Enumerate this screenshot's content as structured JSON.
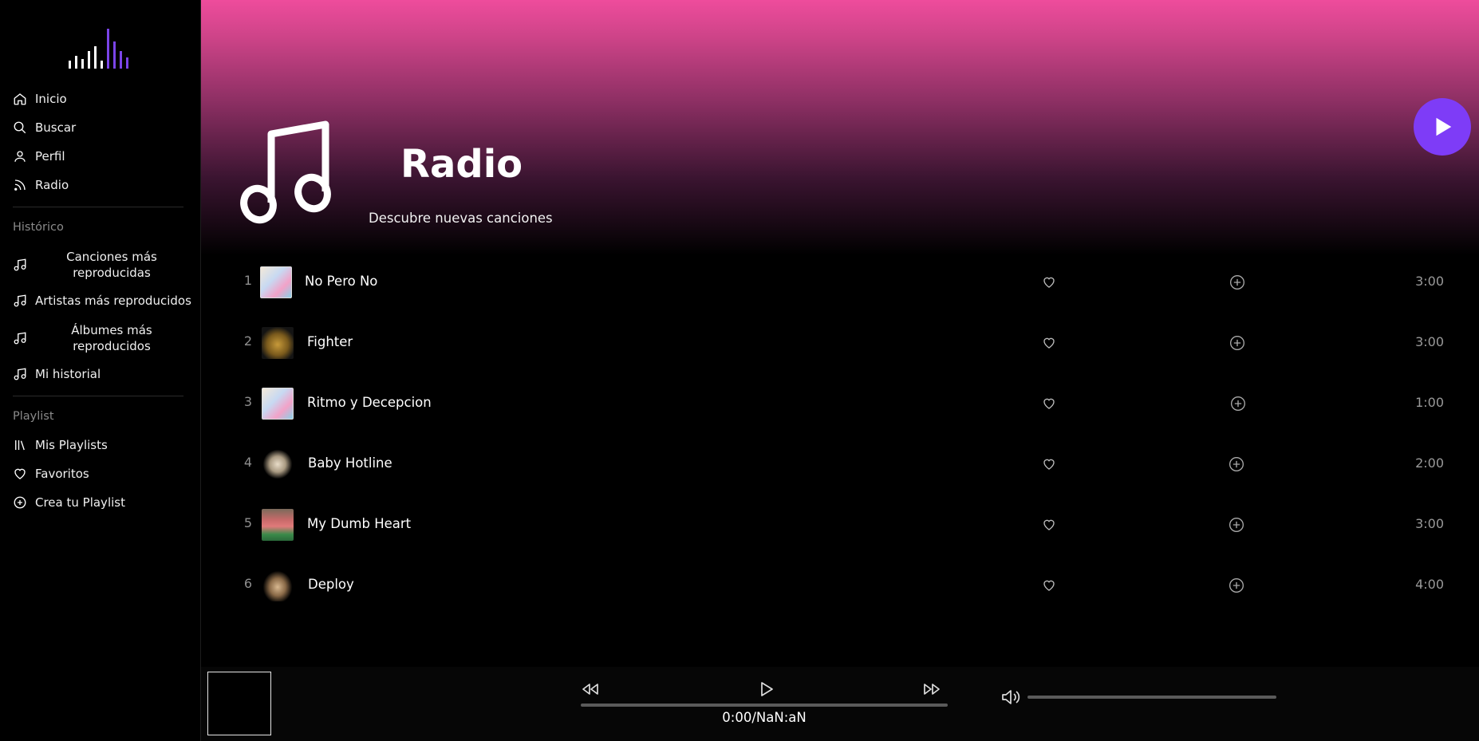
{
  "sidebar": {
    "nav": [
      {
        "label": "Inicio",
        "icon": "home-icon"
      },
      {
        "label": "Buscar",
        "icon": "search-icon"
      },
      {
        "label": "Perfil",
        "icon": "user-icon"
      },
      {
        "label": "Radio",
        "icon": "rss-icon"
      }
    ],
    "history_label": "Histórico",
    "history": [
      {
        "label": "Canciones más reproducidas",
        "icon": "music-note-icon"
      },
      {
        "label": "Artistas más reproducidos",
        "icon": "music-note-icon"
      },
      {
        "label": "Álbumes más reproducidos",
        "icon": "music-note-icon"
      },
      {
        "label": "Mi historial",
        "icon": "music-note-icon"
      }
    ],
    "playlist_label": "Playlist",
    "playlist": [
      {
        "label": "Mis Playlists",
        "icon": "library-icon"
      },
      {
        "label": "Favoritos",
        "icon": "heart-icon"
      },
      {
        "label": "Crea tu Playlist",
        "icon": "plus-circle-icon"
      }
    ]
  },
  "hero": {
    "title": "Radio",
    "subtitle": "Descubre nuevas canciones",
    "gradient_top": "#ee4c9c",
    "accent": "#7e3cf7"
  },
  "tracks": [
    {
      "num": "1",
      "title": "No Pero No",
      "duration": "3:00"
    },
    {
      "num": "2",
      "title": "Fighter",
      "duration": "3:00"
    },
    {
      "num": "3",
      "title": "Ritmo y Decepcion",
      "duration": "1:00"
    },
    {
      "num": "4",
      "title": "Baby Hotline",
      "duration": "2:00"
    },
    {
      "num": "5",
      "title": "My Dumb Heart",
      "duration": "3:00"
    },
    {
      "num": "6",
      "title": "Deploy",
      "duration": "4:00"
    }
  ],
  "player": {
    "time": "0:00/NaN:aN",
    "progress": 0,
    "volume": 1
  }
}
